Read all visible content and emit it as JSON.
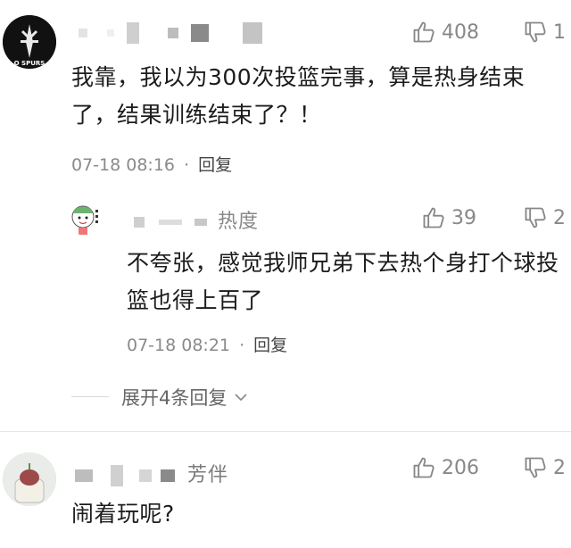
{
  "comments": [
    {
      "username_visible": "",
      "avatar_text": "O SPURS",
      "likes": "408",
      "dislikes": "1",
      "text": "我靠，我以为300次投篮完事，算是热身结束了，结果训练结束了？！",
      "time": "07-18 08:16",
      "separator": "·",
      "reply_label": "回复",
      "replies": [
        {
          "username_visible": "热度",
          "likes": "39",
          "dislikes": "2",
          "text": "不夸张，感觉我师兄弟下去热个身打个球投篮也得上百了",
          "time": "07-18 08:21",
          "separator": "·",
          "reply_label": "回复"
        }
      ],
      "expand_label": "展开4条回复"
    },
    {
      "username_visible": "芳伴",
      "likes": "206",
      "dislikes": "2",
      "text": "闹着玩呢?"
    }
  ],
  "colors": {
    "muted": "#8a8a8a",
    "text": "#1c1c1c",
    "divider": "#e6e6e6"
  },
  "icons": [
    "thumbs-up-icon",
    "thumbs-down-icon",
    "chevron-down-icon"
  ]
}
